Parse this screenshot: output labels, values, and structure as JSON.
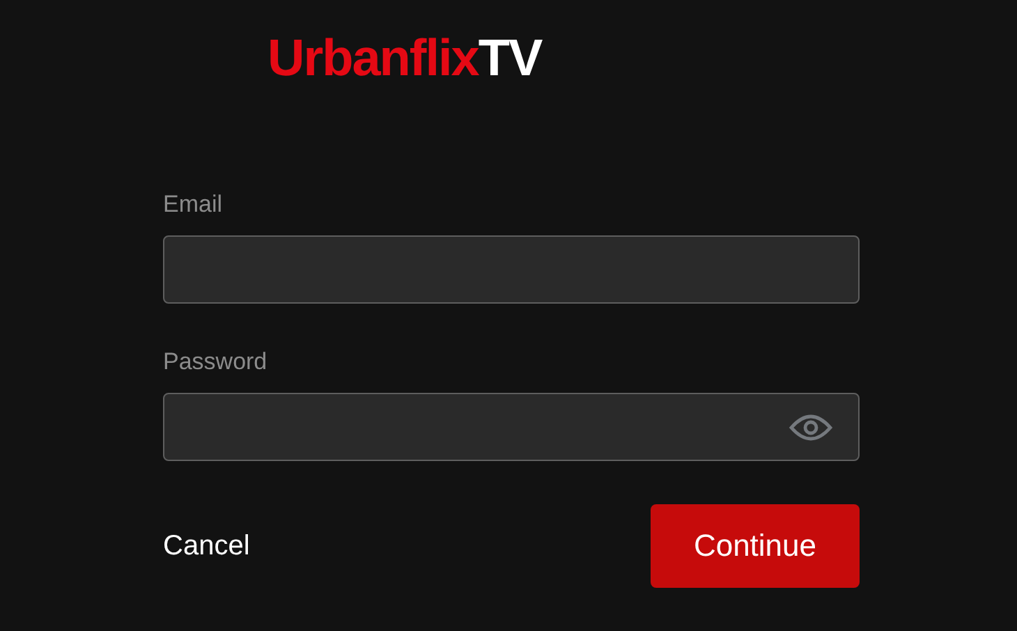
{
  "logo": {
    "brand": "Urbanflix",
    "suffix": "TV"
  },
  "fields": [
    {
      "label": "Email",
      "kind": "text"
    },
    {
      "label": "Password",
      "kind": "password"
    }
  ],
  "actions": {
    "cancel": "Cancel",
    "continue": "Continue"
  }
}
